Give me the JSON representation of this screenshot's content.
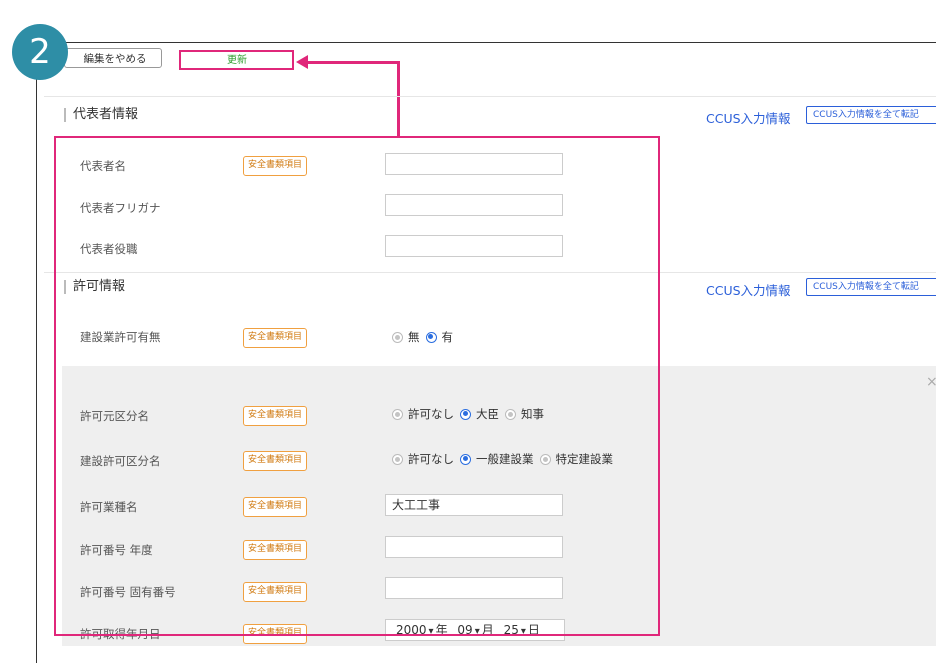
{
  "step_number": "2",
  "toolbar": {
    "cancel_label": "編集をやめる",
    "update_label": "更新"
  },
  "representative": {
    "section_title": "代表者情報",
    "ccus_link": "CCUS入力情報",
    "ccus_copy_button": "CCUS入力情報を全て転記",
    "fields": {
      "name_label": "代表者名",
      "name_tag": "安全書類項目",
      "name_value": "",
      "kana_label": "代表者フリガナ",
      "kana_value": "",
      "title_label": "代表者役職",
      "title_value": ""
    }
  },
  "permit": {
    "section_title": "許可情報",
    "ccus_link": "CCUS入力情報",
    "ccus_copy_button": "CCUS入力情報を全て転記",
    "has_permit": {
      "label": "建設業許可有無",
      "tag": "安全書類項目",
      "options": [
        "無",
        "有"
      ],
      "selected": "有"
    },
    "permit_source": {
      "label": "許可元区分名",
      "tag": "安全書類項目",
      "options": [
        "許可なし",
        "大臣",
        "知事"
      ],
      "selected": "大臣"
    },
    "permit_type": {
      "label": "建設許可区分名",
      "tag": "安全書類項目",
      "options": [
        "許可なし",
        "一般建設業",
        "特定建設業"
      ],
      "selected": "一般建設業"
    },
    "industry": {
      "label": "許可業種名",
      "tag": "安全書類項目",
      "value": "大工工事"
    },
    "number_year": {
      "label": "許可番号 年度",
      "tag": "安全書類項目",
      "value": ""
    },
    "number_unique": {
      "label": "許可番号 固有番号",
      "tag": "安全書類項目",
      "value": ""
    },
    "date": {
      "label": "許可取得年月日",
      "tag": "安全書類項目",
      "year": "2000",
      "year_unit": "年",
      "month": "09",
      "month_unit": "月",
      "day": "25",
      "day_unit": "日"
    },
    "close_symbol": "×"
  },
  "colors": {
    "highlight": "#e0277a",
    "accent": "#2b6ee0",
    "link": "#2b5fd9",
    "tag": "#d07a10",
    "badge": "#2e8ea6"
  }
}
